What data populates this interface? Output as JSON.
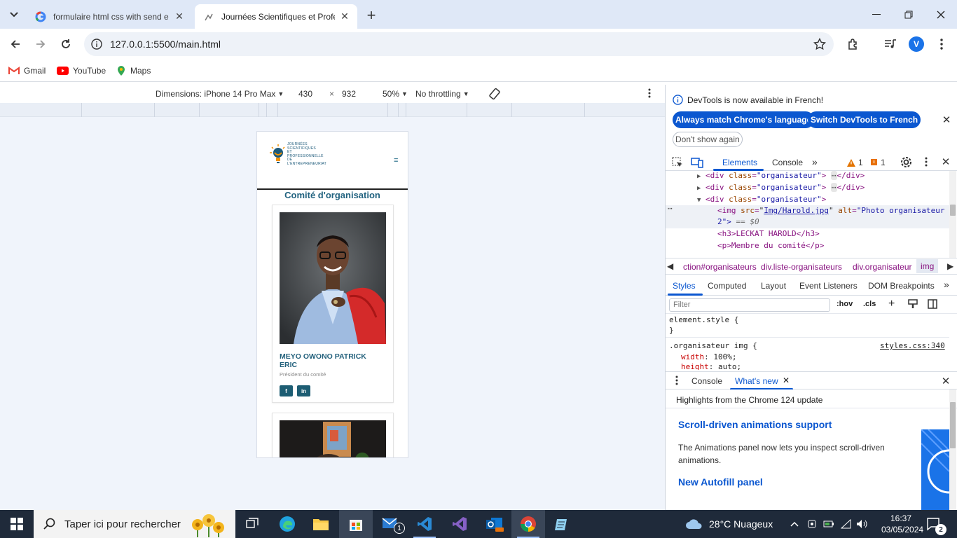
{
  "browser": {
    "tabs": [
      {
        "title": "formulaire html css with send e",
        "icon": "google-g-icon",
        "active": false
      },
      {
        "title": "Journées Scientifiques et Profes",
        "icon": "site-logo-icon",
        "active": true
      }
    ],
    "url": "127.0.0.1:5500/main.html",
    "profile_initial": "V",
    "bookmarks": [
      {
        "label": "Gmail",
        "icon": "gmail-icon"
      },
      {
        "label": "YouTube",
        "icon": "youtube-icon"
      },
      {
        "label": "Maps",
        "icon": "maps-icon"
      }
    ]
  },
  "device_toolbar": {
    "device": "Dimensions: iPhone 14 Pro Max",
    "width": "430",
    "times": "×",
    "height": "932",
    "zoom": "50%",
    "throttling": "No throttling"
  },
  "phone_page": {
    "logo_lines": [
      "JOURNÉES",
      "SCIENTIFIQUES",
      "ET PROFESSIONNELLE",
      "DE L'ENTREPRENEURIAT"
    ],
    "menu_icon": "≡",
    "section_title": "Comité d'organisation",
    "organizers": [
      {
        "name": "MEYO OWONO PATRICK ERIC",
        "role": "Président du comité",
        "social": [
          "f",
          "in"
        ]
      }
    ]
  },
  "devtools": {
    "infobar_message": "DevTools is now available in French!",
    "btn_match": "Always match Chrome's language",
    "btn_switch": "Switch DevTools to French",
    "btn_dont_show": "Don't show again",
    "tabs": [
      "Elements",
      "Console"
    ],
    "warnings_count": "1",
    "errors_count": "1",
    "dom_lines": [
      {
        "open": "<div ",
        "attr": "class",
        "val": "\"organisateur\"",
        "close": "> ",
        "end": "</div>",
        "ellipsis": "⋯"
      },
      {
        "open": "<div ",
        "attr": "class",
        "val": "\"organisateur\"",
        "close": "> ",
        "end": "</div>",
        "ellipsis": "⋯"
      },
      {
        "open": "<div ",
        "attr": "class",
        "val": "\"organisateur\"",
        "close": ">"
      }
    ],
    "selected_img": {
      "src": "Img/Harold.jpg",
      "alt": "\"Photo organisateur",
      "alt_cont": "2\">",
      "suffix": "== $0"
    },
    "h3_line": "<h3>LECKAT HAROLD</h3>",
    "p_line": "<p>Membre du comité</p>",
    "breadcrumbs": [
      "ction#organisateurs",
      "div.liste-organisateurs",
      "div.organisateur",
      "img"
    ],
    "styles_tabs": [
      "Styles",
      "Computed",
      "Layout",
      "Event Listeners",
      "DOM Breakpoints"
    ],
    "filter_placeholder": "Filter",
    "hov": ":hov",
    "cls": ".cls",
    "rules": {
      "element_style": "element.style {",
      "close": "}",
      "selector": ".organisateur img {",
      "source": "styles.css:340",
      "prop1": "width",
      "val1": "100%;",
      "prop2": "height",
      "val2": "auto;"
    },
    "drawer_tabs": [
      "Console",
      "What's new"
    ],
    "whats_new": {
      "highlights": "Highlights from the Chrome 124 update",
      "title1": "Scroll-driven animations support",
      "text1": "The Animations panel now lets you inspect scroll-driven animations.",
      "title2": "New Autofill panel"
    }
  },
  "taskbar": {
    "search_placeholder": "Taper ici pour rechercher",
    "weather": "28°C  Nuageux",
    "time": "16:37",
    "date": "03/05/2024",
    "mail_badge": "1",
    "notif_badge": "2"
  },
  "colors": {
    "accent": "#0b57d0",
    "page_title": "#226380",
    "social_btn": "#1d5d73",
    "tab_strip": "#dfe8f7"
  }
}
